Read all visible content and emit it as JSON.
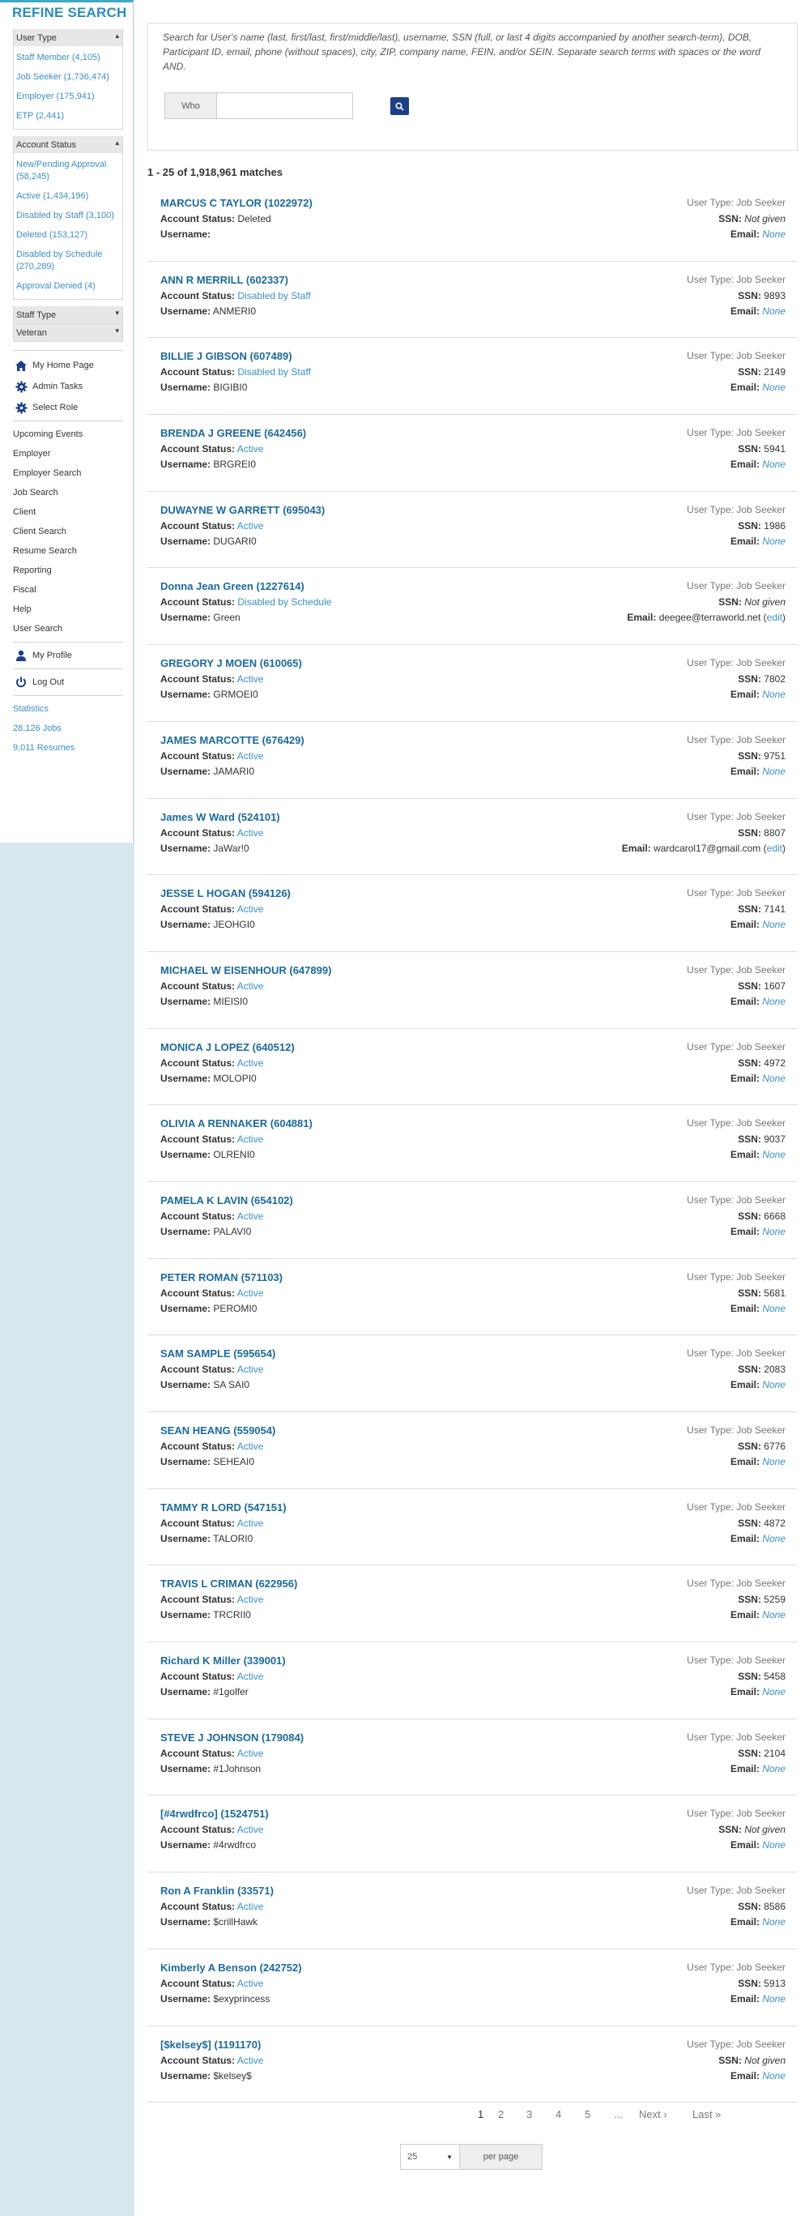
{
  "sidebar": {
    "title": "REFINE SEARCH",
    "user_type": {
      "heading": "User Type",
      "items": [
        "Staff Member (4,105)",
        "Job Seeker (1,736,474)",
        "Employer (175,941)",
        "ETP (2,441)"
      ]
    },
    "account_status": {
      "heading": "Account Status",
      "items": [
        "New/Pending Approval (58,245)",
        "Active (1,434,196)",
        "Disabled by Staff (3,100)",
        "Deleted (153,127)",
        "Disabled by Schedule (270,289)",
        "Approval Denied (4)"
      ]
    },
    "staff_type": "Staff Type",
    "veteran": "Veteran",
    "icon_links": {
      "home": "My Home Page",
      "admin": "Admin Tasks",
      "role": "Select Role"
    },
    "nav": [
      "Upcoming Events",
      "Employer",
      "Employer Search",
      "Job Search",
      "Client",
      "Client Search",
      "Resume Search",
      "Reporting",
      "Fiscal",
      "Help",
      "User Search"
    ],
    "profile": "My Profile",
    "logout": "Log Out",
    "stats": [
      "Statistics",
      "28,126 Jobs",
      "9,011 Resumes"
    ]
  },
  "search": {
    "help_text": "Search for User's name (last, first/last, first/middle/last), username, SSN (full, or last 4 digits accompanied by another search-term), DOB, Participant ID, email, phone (without spaces), city, ZIP, company name, FEIN, and/or SEIN. Separate search terms with spaces or the word AND.",
    "who_label": "Who",
    "who_value": ""
  },
  "match_count": "1 - 25 of 1,918,961 matches",
  "labels": {
    "status": "Account Status:",
    "username": "Username:",
    "ssn": "SSN:",
    "email": "Email:"
  },
  "results": [
    {
      "name": "MARCUS C TAYLOR (1022972)",
      "type": "User Type: Job Seeker",
      "status": "Deleted",
      "status_link": false,
      "username": "",
      "ssn": "Not given",
      "email": "None"
    },
    {
      "name": "ANN R MERRILL (602337)",
      "type": "User Type: Job Seeker",
      "status": "Disabled by Staff",
      "status_link": true,
      "username": "ANMERI0",
      "ssn": "9893",
      "email": "None"
    },
    {
      "name": "BILLIE J GIBSON (607489)",
      "type": "User Type: Job Seeker",
      "status": "Disabled by Staff",
      "status_link": true,
      "username": "BIGIBI0",
      "ssn": "2149",
      "email": "None"
    },
    {
      "name": "BRENDA J GREENE (642456)",
      "type": "User Type: Job Seeker",
      "status": "Active",
      "status_link": true,
      "username": "BRGREI0",
      "ssn": "5941",
      "email": "None"
    },
    {
      "name": "DUWAYNE W GARRETT (695043)",
      "type": "User Type: Job Seeker",
      "status": "Active",
      "status_link": true,
      "username": "DUGARI0",
      "ssn": "1986",
      "email": "None"
    },
    {
      "name": "Donna Jean Green (1227614)",
      "type": "User Type: Job Seeker",
      "status": "Disabled by Schedule",
      "status_link": true,
      "username": "Green",
      "ssn": "Not given",
      "email": "deegee@terraworld.net",
      "edit": "edit"
    },
    {
      "name": "GREGORY J MOEN (610065)",
      "type": "User Type: Job Seeker",
      "status": "Active",
      "status_link": true,
      "username": "GRMOEI0",
      "ssn": "7802",
      "email": "None"
    },
    {
      "name": "JAMES MARCOTTE (676429)",
      "type": "User Type: Job Seeker",
      "status": "Active",
      "status_link": true,
      "username": "JAMARI0",
      "ssn": "9751",
      "email": "None"
    },
    {
      "name": "James W Ward (524101)",
      "type": "User Type: Job Seeker",
      "status": "Active",
      "status_link": true,
      "username": "JaWar!0",
      "ssn": "8807",
      "email": "wardcarol17@gmail.com",
      "edit": "edit"
    },
    {
      "name": "JESSE L HOGAN (594126)",
      "type": "User Type: Job Seeker",
      "status": "Active",
      "status_link": true,
      "username": "JEOHGI0",
      "ssn": "7141",
      "email": "None"
    },
    {
      "name": "MICHAEL W EISENHOUR (647899)",
      "type": "User Type: Job Seeker",
      "status": "Active",
      "status_link": true,
      "username": "MIEISI0",
      "ssn": "1607",
      "email": "None"
    },
    {
      "name": "MONICA J LOPEZ (640512)",
      "type": "User Type: Job Seeker",
      "status": "Active",
      "status_link": true,
      "username": "MOLOPI0",
      "ssn": "4972",
      "email": "None"
    },
    {
      "name": "OLIVIA A RENNAKER (604881)",
      "type": "User Type: Job Seeker",
      "status": "Active",
      "status_link": true,
      "username": "OLRENI0",
      "ssn": "9037",
      "email": "None"
    },
    {
      "name": "PAMELA K LAVIN (654102)",
      "type": "User Type: Job Seeker",
      "status": "Active",
      "status_link": true,
      "username": "PALAVI0",
      "ssn": "6668",
      "email": "None"
    },
    {
      "name": "PETER ROMAN (571103)",
      "type": "User Type: Job Seeker",
      "status": "Active",
      "status_link": true,
      "username": "PEROMI0",
      "ssn": "5681",
      "email": "None"
    },
    {
      "name": "SAM SAMPLE (595654)",
      "type": "User Type: Job Seeker",
      "status": "Active",
      "status_link": true,
      "username": "SA SAI0",
      "ssn": "2083",
      "email": "None"
    },
    {
      "name": "SEAN HEANG (559054)",
      "type": "User Type: Job Seeker",
      "status": "Active",
      "status_link": true,
      "username": "SEHEAI0",
      "ssn": "6776",
      "email": "None"
    },
    {
      "name": "TAMMY R LORD (547151)",
      "type": "User Type: Job Seeker",
      "status": "Active",
      "status_link": true,
      "username": "TALORI0",
      "ssn": "4872",
      "email": "None"
    },
    {
      "name": "TRAVIS L CRIMAN (622956)",
      "type": "User Type: Job Seeker",
      "status": "Active",
      "status_link": true,
      "username": "TRCRII0",
      "ssn": "5259",
      "email": "None"
    },
    {
      "name": "Richard K Miller (339001)",
      "type": "User Type: Job Seeker",
      "status": "Active",
      "status_link": true,
      "username": "#1golfer",
      "ssn": "5458",
      "email": "None"
    },
    {
      "name": "STEVE J JOHNSON (179084)",
      "type": "User Type: Job Seeker",
      "status": "Active",
      "status_link": true,
      "username": "#1Johnson",
      "ssn": "2104",
      "email": "None"
    },
    {
      "name": "[#4rwdfrco] (1524751)",
      "type": "User Type: Job Seeker",
      "status": "Active",
      "status_link": true,
      "username": "#4rwdfrco",
      "ssn": "Not given",
      "email": "None"
    },
    {
      "name": "Ron A Franklin (33571)",
      "type": "User Type: Job Seeker",
      "status": "Active",
      "status_link": true,
      "username": "$crillHawk",
      "ssn": "8586",
      "email": "None"
    },
    {
      "name": "Kimberly A Benson (242752)",
      "type": "User Type: Job Seeker",
      "status": "Active",
      "status_link": true,
      "username": "$exyprincess",
      "ssn": "5913",
      "email": "None"
    },
    {
      "name": "[$kelsey$] (1191170)",
      "type": "User Type: Job Seeker",
      "status": "Active",
      "status_link": true,
      "username": "$kelsey$",
      "ssn": "Not given",
      "email": "None"
    }
  ],
  "pagination": {
    "pages": [
      "1",
      "2",
      "3",
      "4",
      "5",
      "..."
    ],
    "current": "1",
    "next": "Next ›",
    "last": "Last »"
  },
  "per_page": {
    "value": "25",
    "label": "per page"
  },
  "colors": {
    "accent": "#3fa9c7",
    "link": "#3b8fc2",
    "name": "#1c6a99",
    "button": "#1d3f86",
    "background": "#d7e8ee"
  }
}
